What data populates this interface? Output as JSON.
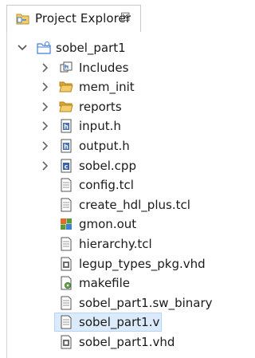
{
  "view": {
    "title": "Project Explorer",
    "close_glyph": "☒"
  },
  "tree": {
    "project": {
      "label": "sobel_part1",
      "icon": "project-folder-icon",
      "expanded": true
    },
    "items": [
      {
        "label": "Includes",
        "icon": "includes-icon",
        "expandable": true
      },
      {
        "label": "mem_init",
        "icon": "folder-icon",
        "expandable": true
      },
      {
        "label": "reports",
        "icon": "folder-icon",
        "expandable": true
      },
      {
        "label": "input.h",
        "icon": "header-file-icon",
        "expandable": true
      },
      {
        "label": "output.h",
        "icon": "header-file-icon",
        "expandable": true
      },
      {
        "label": "sobel.cpp",
        "icon": "cpp-file-icon",
        "expandable": true
      },
      {
        "label": "config.tcl",
        "icon": "text-file-icon",
        "expandable": false
      },
      {
        "label": "create_hdl_plus.tcl",
        "icon": "text-file-icon",
        "expandable": false
      },
      {
        "label": "gmon.out",
        "icon": "gmon-file-icon",
        "expandable": false
      },
      {
        "label": "hierarchy.tcl",
        "icon": "text-file-icon",
        "expandable": false
      },
      {
        "label": "legup_types_pkg.vhd",
        "icon": "vhd-file-icon",
        "expandable": false
      },
      {
        "label": "makefile",
        "icon": "makefile-icon",
        "expandable": false
      },
      {
        "label": "sobel_part1.sw_binary",
        "icon": "text-file-icon",
        "expandable": false
      },
      {
        "label": "sobel_part1.v",
        "icon": "text-file-icon",
        "expandable": false,
        "selected": true
      },
      {
        "label": "sobel_part1.vhd",
        "icon": "vhd-file-icon",
        "expandable": false
      }
    ]
  },
  "colors": {
    "selection_bg": "#dcebfb",
    "selection_border": "#b4d5f6",
    "folder": "#e9b949",
    "project_folder": "#3f7fd6"
  }
}
